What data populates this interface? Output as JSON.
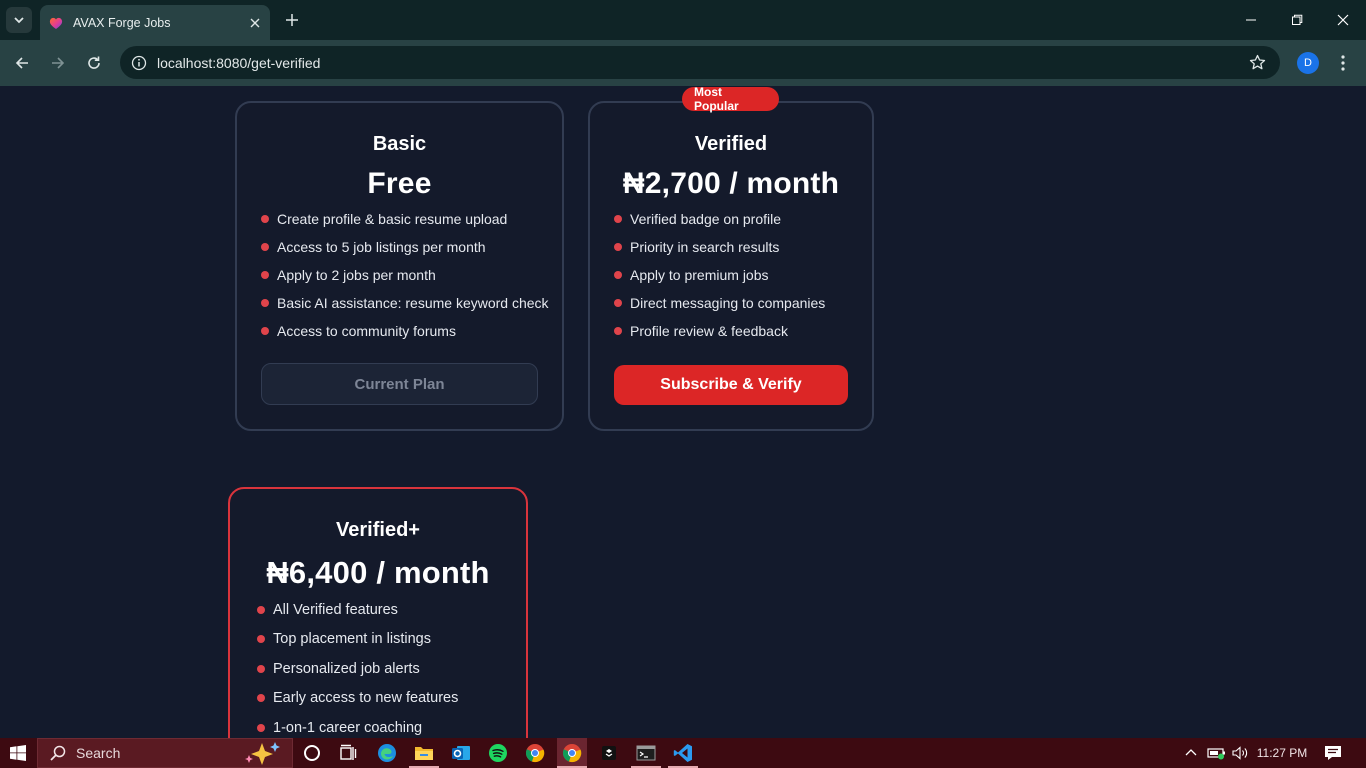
{
  "browser": {
    "tab_title": "AVAX Forge Jobs",
    "url": "localhost:8080/get-verified",
    "profile_initial": "D"
  },
  "plans": {
    "basic": {
      "name": "Basic",
      "price": "Free",
      "features": [
        "Create profile & basic resume upload",
        "Access to 5 job listings per month",
        "Apply to 2 jobs per month",
        "Basic AI assistance: resume keyword check",
        "Access to community forums"
      ],
      "button_label": "Current Plan"
    },
    "verified": {
      "badge": "Most Popular",
      "name": "Verified",
      "price": "₦2,700 / month",
      "features": [
        "Verified badge on profile",
        "Priority in search results",
        "Apply to premium jobs",
        "Direct messaging to companies",
        "Profile review & feedback"
      ],
      "button_label": "Subscribe & Verify"
    },
    "verified_plus": {
      "name": "Verified+",
      "price": "₦6,400 / month",
      "features": [
        "All Verified features",
        "Top placement in listings",
        "Personalized job alerts",
        "Early access to new features",
        "1-on-1 career coaching"
      ]
    }
  },
  "taskbar": {
    "search_placeholder": "Search",
    "time": "11:27 PM",
    "apps": [
      "task-view",
      "edge",
      "file-explorer",
      "outlook",
      "spotify",
      "chrome",
      "chrome-active",
      "terminal-app",
      "cmd",
      "vscode"
    ]
  },
  "colors": {
    "accent_red": "#dc2626",
    "page_bg": "#131a2c",
    "chrome_bg": "#284244",
    "taskbar_bg": "#3d0a11"
  }
}
